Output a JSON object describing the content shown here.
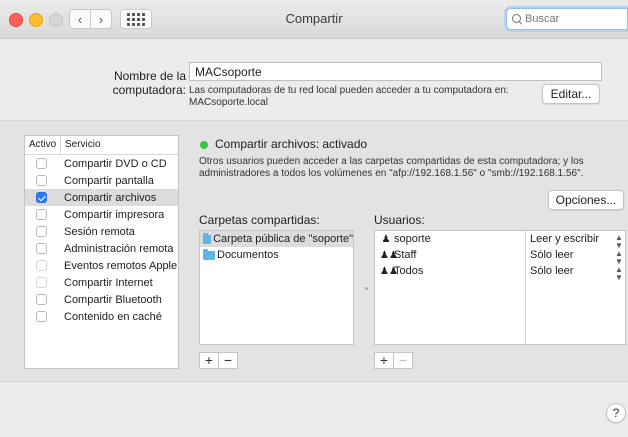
{
  "window": {
    "title": "Compartir"
  },
  "search": {
    "placeholder": "Buscar"
  },
  "computer_name": {
    "label": "Nombre de la computadora:",
    "value": "MACsoporte",
    "description": "Las computadoras de tu red local pueden acceder a tu computadora en: MACsoporte.local",
    "edit_button": "Editar..."
  },
  "services": {
    "header_active": "Activo",
    "header_service": "Servicio",
    "items": [
      {
        "label": "Compartir DVD o CD",
        "checked": false
      },
      {
        "label": "Compartir pantalla",
        "checked": false
      },
      {
        "label": "Compartir archivos",
        "checked": true
      },
      {
        "label": "Compartir impresora",
        "checked": false
      },
      {
        "label": "Sesión remota",
        "checked": false
      },
      {
        "label": "Administración remota",
        "checked": false
      },
      {
        "label": "Eventos remotos Apple",
        "checked": false
      },
      {
        "label": "Compartir Internet",
        "checked": false
      },
      {
        "label": "Compartir Bluetooth",
        "checked": false
      },
      {
        "label": "Contenido en caché",
        "checked": false
      }
    ]
  },
  "detail": {
    "status": "Compartir archivos: activado",
    "status_color": "#3bc441",
    "description": "Otros usuarios pueden acceder a las carpetas compartidas de esta computadora; y los administradores a todos los volúmenes en \"afp://192.168.1.56\" o \"smb://192.168.1.56\".",
    "options_button": "Opciones...",
    "folders_label": "Carpetas compartidas:",
    "users_label": "Usuarios:",
    "folders": [
      {
        "name": "Carpeta pública de \"soporte\""
      },
      {
        "name": "Documentos"
      }
    ],
    "users": [
      {
        "name": "soporte",
        "icon": "person-icon",
        "permission": "Leer y escribir"
      },
      {
        "name": "Staff",
        "icon": "group-icon",
        "permission": "Sólo leer"
      },
      {
        "name": "Todos",
        "icon": "everyone-icon",
        "permission": "Sólo leer"
      }
    ],
    "add_symbol": "+",
    "remove_symbol": "−"
  },
  "help": {
    "symbol": "?"
  }
}
